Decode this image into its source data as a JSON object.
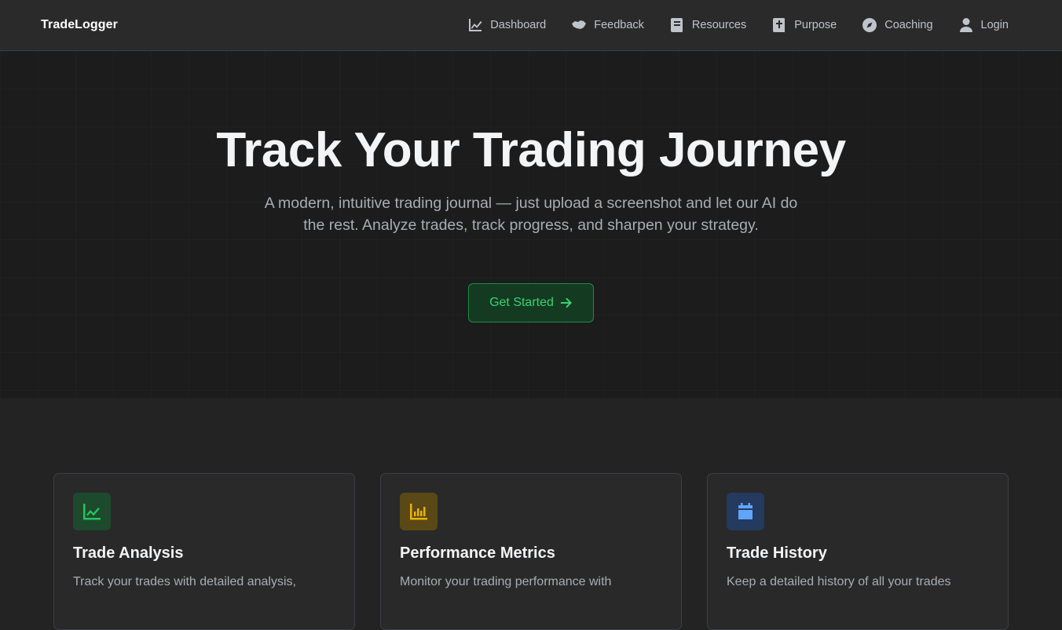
{
  "brand": "TradeLogger",
  "nav": {
    "dashboard": "Dashboard",
    "feedback": "Feedback",
    "resources": "Resources",
    "purpose": "Purpose",
    "coaching": "Coaching",
    "login": "Login"
  },
  "hero": {
    "title": "Track Your Trading Journey",
    "subtitle": "A modern, intuitive trading journal — just upload a screenshot and let our AI do the rest. Analyze trades, track progress, and sharpen your strategy.",
    "cta_label": "Get Started"
  },
  "features": [
    {
      "title": "Trade Analysis",
      "description": "Track your trades with detailed analysis,",
      "icon": "chart-line-icon",
      "color": "#22c55e"
    },
    {
      "title": "Performance Metrics",
      "description": "Monitor your trading performance with",
      "icon": "bar-chart-icon",
      "color": "#eab308"
    },
    {
      "title": "Trade History",
      "description": "Keep a detailed history of all your trades",
      "icon": "calendar-icon",
      "color": "#3b82f6"
    }
  ],
  "colors": {
    "accent_green": "#38d46f",
    "background": "#1c1c1c",
    "nav_background": "#2a2a2a"
  }
}
